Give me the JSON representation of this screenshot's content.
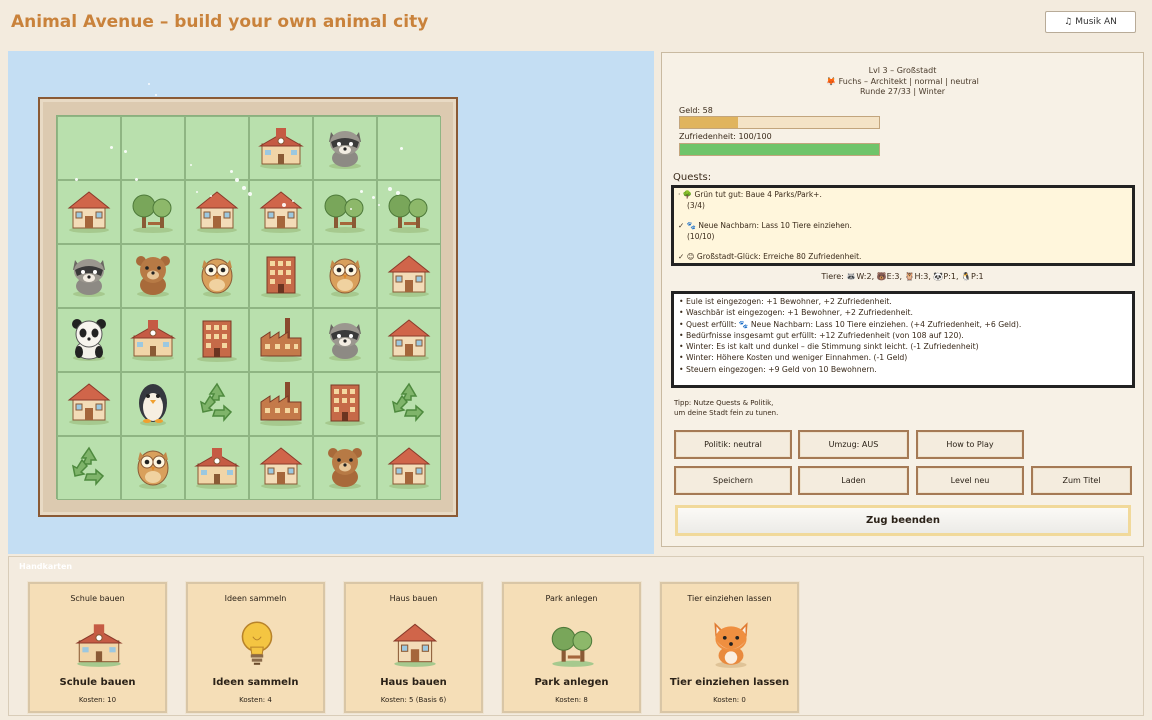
{
  "header": {
    "title": "Animal Avenue – build your own animal city",
    "music_label": "Musik AN",
    "music_icon": "music-note-icon"
  },
  "board": {
    "rows": [
      [
        "empty",
        "empty",
        "empty",
        "school",
        "raccoon",
        "empty"
      ],
      [
        "house",
        "park",
        "house",
        "house",
        "park",
        "park"
      ],
      [
        "raccoon",
        "bear",
        "owl",
        "apartment",
        "owl",
        "house"
      ],
      [
        "panda",
        "school",
        "apartment",
        "factory",
        "raccoon",
        "house"
      ],
      [
        "house",
        "penguin",
        "recycling",
        "factory",
        "apartment",
        "recycling"
      ],
      [
        "recycling",
        "owl",
        "school",
        "house",
        "bear",
        "house"
      ]
    ]
  },
  "status": {
    "level_line": "Lvl 3 – Großstadt",
    "role_line": "🦊 Fuchs – Architekt | normal | neutral",
    "round_line": "Runde 27/33 | Winter",
    "money_label": "Geld: 58",
    "money_fraction": 0.29,
    "money_color": "#e0b45e",
    "happiness_label": "Zufriedenheit: 100/100",
    "happiness_fraction": 1.0,
    "happiness_color": "#6fc46a"
  },
  "quests": {
    "label": "Quests:",
    "items": [
      {
        "prefix": "·",
        "text": "🌳 Grün tut gut: Baue 4 Parks/Park+.",
        "sub": "(3/4)"
      },
      {
        "prefix": "✓",
        "text": "🐾 Neue Nachbarn: Lass 10 Tiere einziehen.",
        "sub": "(10/10)"
      },
      {
        "prefix": "✓",
        "text": "😊 Großstadt-Glück: Erreiche 80 Zufriedenheit.",
        "sub": ""
      }
    ]
  },
  "animals_line": "Tiere: 🦝W:2, 🐻E:3, 🦉H:3, 🐼P:1, 🐧P:1",
  "log": [
    "• Eule ist eingezogen: +1 Bewohner, +2 Zufriedenheit.",
    "• Waschbär ist eingezogen: +1 Bewohner, +2 Zufriedenheit.",
    "• Quest erfüllt: 🐾 Neue Nachbarn: Lass 10 Tiere einziehen. (+4 Zufriedenheit, +6 Geld).",
    "• Bedürfnisse insgesamt gut erfüllt: +12 Zufriedenheit (von 108 auf 120).",
    "• Winter: Es ist kalt und dunkel – die Stimmung sinkt leicht. (-1 Zufriedenheit)",
    "• Winter: Höhere Kosten und weniger Einnahmen. (-1 Geld)",
    "• Steuern eingezogen: +9 Geld von 10 Bewohnern."
  ],
  "tip": [
    "Tipp: Nutze Quests & Politik,",
    "um deine Stadt fein zu tunen."
  ],
  "buttons": {
    "policy": "Politik: neutral",
    "move": "Umzug: AUS",
    "howto": "How to Play",
    "save": "Speichern",
    "load": "Laden",
    "newlevel": "Level neu",
    "totitle": "Zum Titel",
    "endturn": "Zug beenden"
  },
  "hand": {
    "label": "Handkarten",
    "cards": [
      {
        "title": "Schule bauen",
        "name": "Schule bauen",
        "cost": "Kosten: 10",
        "icon": "school"
      },
      {
        "title": "Ideen sammeln",
        "name": "Ideen sammeln",
        "cost": "Kosten: 4",
        "icon": "lightbulb"
      },
      {
        "title": "Haus bauen",
        "name": "Haus bauen",
        "cost": "Kosten: 5 (Basis 6)",
        "icon": "house"
      },
      {
        "title": "Park anlegen",
        "name": "Park anlegen",
        "cost": "Kosten: 8",
        "icon": "park"
      },
      {
        "title": "Tier einziehen lassen",
        "name": "Tier einziehen lassen",
        "cost": "Kosten: 0",
        "icon": "fox"
      }
    ]
  }
}
